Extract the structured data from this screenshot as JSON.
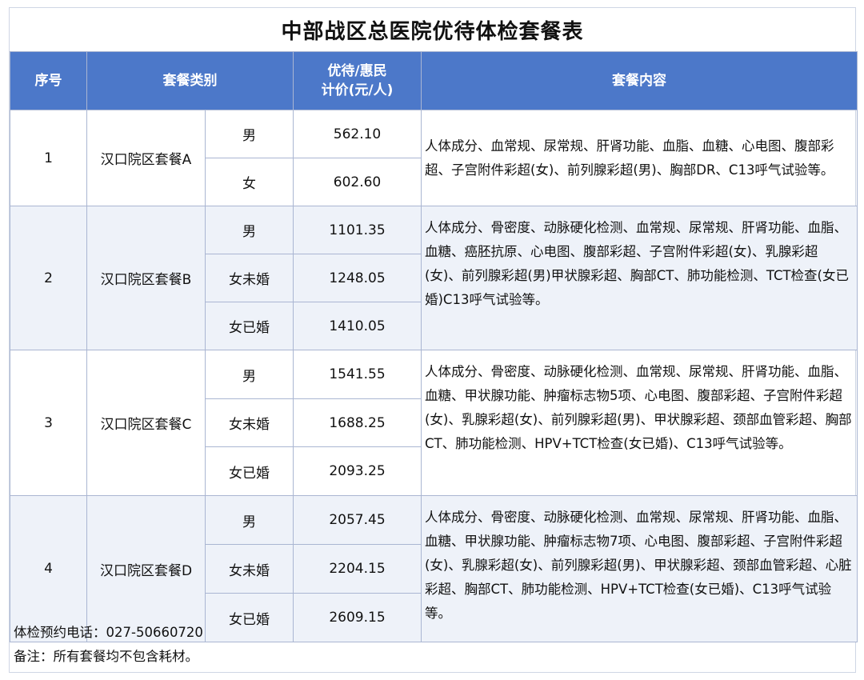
{
  "title": "中部战区总医院优待体检套餐表",
  "headers": {
    "no": "序号",
    "category": "套餐类别",
    "price_line1": "优待/惠民",
    "price_line2": "计价(元/人)",
    "content": "套餐内容"
  },
  "packages": [
    {
      "no": "1",
      "name": "汉口院区套餐A",
      "rows": [
        {
          "gender": "男",
          "price": "562.10"
        },
        {
          "gender": "女",
          "price": "602.60"
        }
      ],
      "content": "人体成分、血常规、尿常规、肝肾功能、血脂、血糖、心电图、腹部彩超、子宫附件彩超(女)、前列腺彩超(男)、胸部DR、C13呼气试验等。"
    },
    {
      "no": "2",
      "name": "汉口院区套餐B",
      "rows": [
        {
          "gender": "男",
          "price": "1101.35"
        },
        {
          "gender": "女未婚",
          "price": "1248.05"
        },
        {
          "gender": "女已婚",
          "price": "1410.05"
        }
      ],
      "content": "人体成分、骨密度、动脉硬化检测、血常规、尿常规、肝肾功能、血脂、血糖、癌胚抗原、心电图、腹部彩超、子宫附件彩超(女)、乳腺彩超(女)、前列腺彩超(男)甲状腺彩超、胸部CT、肺功能检测、TCT检查(女已婚)C13呼气试验等。"
    },
    {
      "no": "3",
      "name": "汉口院区套餐C",
      "rows": [
        {
          "gender": "男",
          "price": "1541.55"
        },
        {
          "gender": "女未婚",
          "price": "1688.25"
        },
        {
          "gender": "女已婚",
          "price": "2093.25"
        }
      ],
      "content": "人体成分、骨密度、动脉硬化检测、血常规、尿常规、肝肾功能、血脂、血糖、甲状腺功能、肿瘤标志物5项、心电图、腹部彩超、子宫附件彩超(女)、乳腺彩超(女)、前列腺彩超(男)、甲状腺彩超、颈部血管彩超、胸部CT、肺功能检测、HPV+TCT检查(女已婚)、C13呼气试验等。"
    },
    {
      "no": "4",
      "name": "汉口院区套餐D",
      "rows": [
        {
          "gender": "男",
          "price": "2057.45"
        },
        {
          "gender": "女未婚",
          "price": "2204.15"
        },
        {
          "gender": "女已婚",
          "price": "2609.15"
        }
      ],
      "content": "人体成分、骨密度、动脉硬化检测、血常规、尿常规、肝肾功能、血脂、血糖、甲状腺功能、肿瘤标志物7项、心电图、腹部彩超、子宫附件彩超(女)、乳腺彩超(女)、前列腺彩超(男)、甲状腺彩超、颈部血管彩超、心脏彩超、胸部CT、肺功能检测、HPV+TCT检查(女已婚)、C13呼气试验等。"
    }
  ],
  "footer": {
    "phone": "体检预约电话：027-50660720",
    "note": "备注：所有套餐均不包含耗材。"
  },
  "colors": {
    "header_bg": "#4c78c9",
    "alt_row_bg": "#eef2f9",
    "border": "#aab6d2"
  }
}
